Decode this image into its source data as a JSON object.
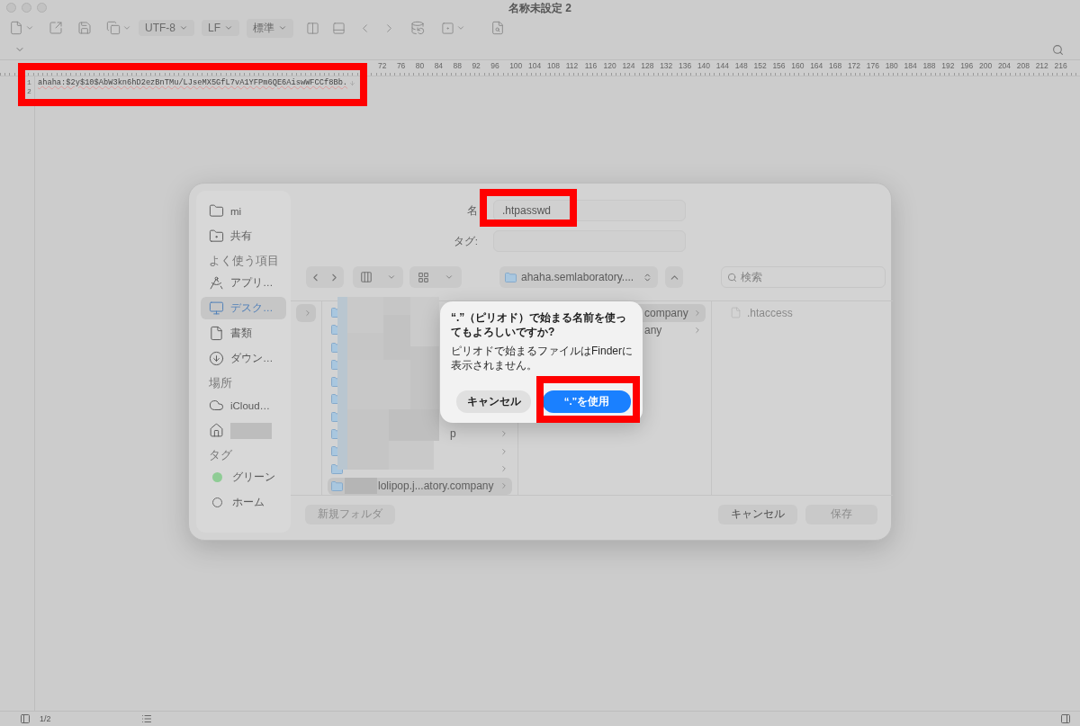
{
  "window": {
    "title": "名称未設定 2"
  },
  "toolbar": {
    "encoding": "UTF-8",
    "line_ending": "LF",
    "mode": "標準"
  },
  "ruler": {
    "ticks": [
      "72",
      "76",
      "80",
      "84",
      "88",
      "92",
      "96",
      "100",
      "104",
      "108",
      "112",
      "116",
      "120",
      "124",
      "128",
      "132",
      "136",
      "140",
      "144",
      "148",
      "152",
      "156",
      "160",
      "164",
      "168",
      "172",
      "176",
      "180",
      "184",
      "188",
      "192",
      "196",
      "200",
      "204",
      "208",
      "212",
      "216"
    ]
  },
  "editor": {
    "lines": [
      {
        "number": "1",
        "text": "ahaha:$2y$10$AbW3kn6hD2ezBnTMu/LJseMX5GfL7vA1YFPm6QE6AiswWFCCf8Bb."
      },
      {
        "number": "2"
      }
    ]
  },
  "save_dialog": {
    "sidebar": [
      {
        "kind": "item",
        "label": "mi",
        "selected": false
      },
      {
        "kind": "item",
        "label": "共有",
        "selected": false
      },
      {
        "kind": "heading",
        "label": "よく使う項目"
      },
      {
        "kind": "item",
        "label": "アプリ…",
        "selected": false
      },
      {
        "kind": "item",
        "label": "デスク…",
        "selected": true
      },
      {
        "kind": "item",
        "label": "書類",
        "selected": false
      },
      {
        "kind": "item",
        "label": "ダウン…",
        "selected": false
      },
      {
        "kind": "heading",
        "label": "場所"
      },
      {
        "kind": "item",
        "label": "iCloud…",
        "selected": false
      },
      {
        "kind": "item",
        "selected": false
      },
      {
        "kind": "heading",
        "label": "タグ"
      },
      {
        "kind": "tag",
        "label": "グリーン",
        "color": "#8fcc95"
      },
      {
        "kind": "tag",
        "label": "ホーム"
      }
    ],
    "name": {
      "label": "名",
      "value": ".htpasswd"
    },
    "tags": {
      "label": "タグ:"
    },
    "location": "ahaha.semlaboratory....",
    "search": {
      "placeholder": "検索"
    },
    "columns": [
      {
        "rows": [
          {
            "selected": true
          }
        ]
      },
      {
        "rows": [
          {
            "selected": false
          },
          {
            "selected": false
          },
          {
            "selected": false
          },
          {
            "selected": false
          },
          {
            "selected": false
          },
          {
            "selected": false
          },
          {
            "selected": false
          },
          {
            "label": "p",
            "selected": false
          },
          {
            "selected": false
          },
          {
            "selected": false
          },
          {
            "label": "lolipop.j...atory.company",
            "selected": true
          }
        ]
      },
      {
        "rows": [
          {
            "label": "company",
            "selected": true
          },
          {
            "label": "any",
            "selected": false
          }
        ]
      },
      {
        "rows": [
          {
            "label": ".htaccess",
            "selected": false
          }
        ]
      }
    ],
    "new_folder": {
      "label": "新規フォルダ",
      "disabled": true
    },
    "buttons": [
      {
        "label": "キャンセル",
        "disabled": false
      },
      {
        "label": "保存",
        "disabled": true
      }
    ]
  },
  "alert": {
    "title": "“.”（ピリオド）で始まる名前を使ってもよろしいですか?",
    "message": "ピリオドで始まるファイルはFinderに表示されません。",
    "buttons": [
      {
        "label": "キャンセル",
        "default": false
      },
      {
        "label": "“.”を使用",
        "default": true
      }
    ]
  },
  "status_bar": {
    "position": "1/2"
  }
}
